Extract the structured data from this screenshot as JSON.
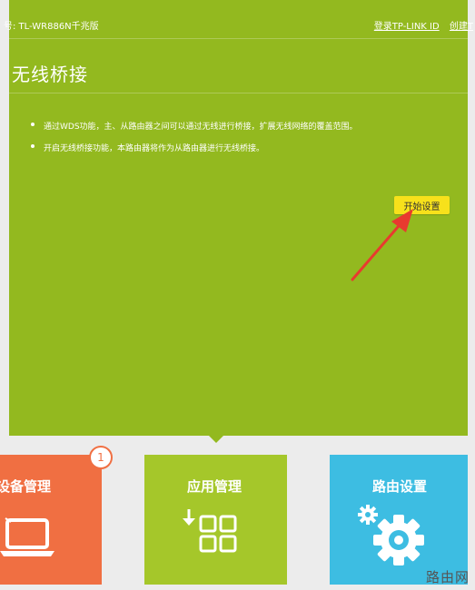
{
  "header": {
    "model_label": "号: TL-WR886N千兆版",
    "login_link": "登录TP-LINK ID",
    "create_link": "创建T"
  },
  "page": {
    "title": "无线桥接",
    "bullets": [
      "通过WDS功能，主、从路由器之间可以通过无线进行桥接，扩展无线网络的覆盖范围。",
      "开启无线桥接功能，本路由器将作为从路由器进行无线桥接。"
    ],
    "start_button": "开始设置"
  },
  "tiles": {
    "device": {
      "label": "设备管理",
      "badge": "1",
      "icon": "laptop-icon"
    },
    "app": {
      "label": "应用管理",
      "icon": "apps-grid-icon"
    },
    "route": {
      "label": "路由设置",
      "icon": "gear-icon"
    }
  },
  "watermark": "路由网",
  "colors": {
    "panel": "#93b91f",
    "device_tile": "#f06f42",
    "app_tile": "#a5c72a",
    "route_tile": "#3dbde2",
    "start_button": "#f7e11b",
    "annotation_arrow": "#e83a2f"
  }
}
